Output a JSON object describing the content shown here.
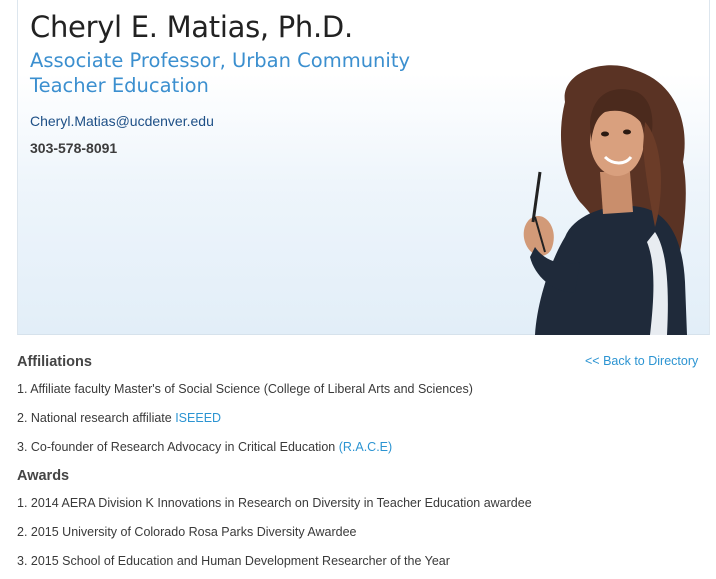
{
  "profile": {
    "name": "Cheryl E. Matias, Ph.D.",
    "title": "Associate Professor, Urban Community Teacher Education",
    "email": "Cheryl.Matias@ucdenver.edu",
    "phone": "303-578-8091",
    "photo_icon": "portrait-photo"
  },
  "navigation": {
    "back_link": "<< Back to Directory"
  },
  "affiliations": {
    "heading": "Affiliations",
    "items": [
      {
        "text": "1. Affiliate faculty Master's of Social Science (College of Liberal Arts and Sciences)",
        "link": ""
      },
      {
        "text": "2. National research affiliate ",
        "link": "ISEEED"
      },
      {
        "text": "3. Co-founder of Research Advocacy in Critical Education ",
        "link": "(R.A.C.E)"
      }
    ]
  },
  "awards": {
    "heading": "Awards",
    "items": [
      {
        "text": "1. 2014 AERA Division K Innovations in Research on Diversity in Teacher Education awardee"
      },
      {
        "text": "2. 2015 University of Colorado Rosa Parks Diversity Awardee"
      },
      {
        "text": "3. 2015 School of Education and Human Development Researcher of the Year"
      }
    ]
  },
  "colors": {
    "accent": "#3b8fcf",
    "link": "#2c94d2",
    "email": "#1d4f86"
  }
}
